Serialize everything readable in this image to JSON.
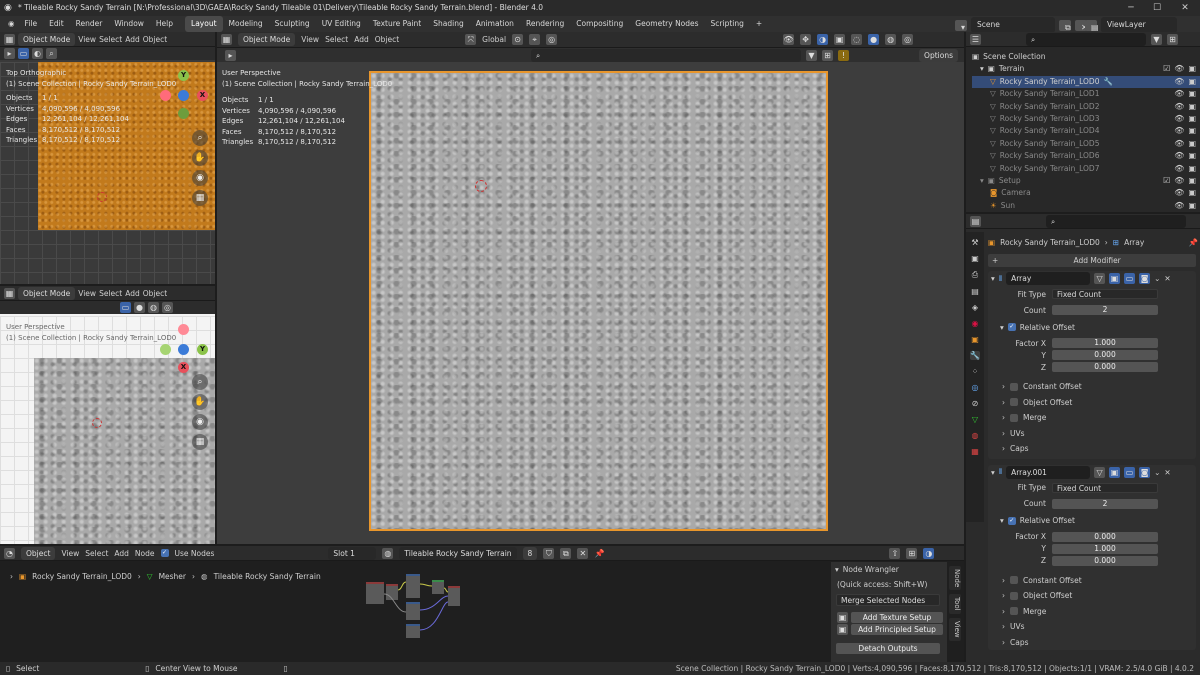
{
  "title": "* Tileable Rocky Sandy Terrain [N:\\Professional\\3D\\GAEA\\Rocky Sandy Tileable 01\\Delivery\\Tileable Rocky Sandy Terrain.blend] - Blender 4.0",
  "menu": [
    "File",
    "Edit",
    "Render",
    "Window",
    "Help"
  ],
  "workspaces": [
    "Layout",
    "Modeling",
    "Sculpting",
    "UV Editing",
    "Texture Paint",
    "Shading",
    "Animation",
    "Rendering",
    "Compositing",
    "Geometry Nodes",
    "Scripting"
  ],
  "active_workspace": "Layout",
  "scene": "Scene",
  "view_layer": "ViewLayer",
  "viewport_header": {
    "mode": "Object Mode",
    "view": "View",
    "select": "Select",
    "add": "Add",
    "object": "Object",
    "orientation": "Global",
    "options": "Options"
  },
  "vp_topleft": {
    "view_name": "Top Orthographic",
    "collection": "(1) Scene Collection | Rocky Sandy Terrain_LOD0",
    "stats": [
      [
        "Objects",
        "1 / 1"
      ],
      [
        "Vertices",
        "4,090,596 / 4,090,596"
      ],
      [
        "Edges",
        "12,261,104 / 12,261,104"
      ],
      [
        "Faces",
        "8,170,512 / 8,170,512"
      ],
      [
        "Triangles",
        "8,170,512 / 8,170,512"
      ]
    ]
  },
  "vp_bottomleft": {
    "view_name": "User Perspective",
    "collection": "(1) Scene Collection | Rocky Sandy Terrain_LOD0"
  },
  "vp_main": {
    "view_name": "User Perspective",
    "collection": "(1) Scene Collection | Rocky Sandy Terrain_LOD0",
    "stats": [
      [
        "Objects",
        "1 / 1"
      ],
      [
        "Vertices",
        "4,090,596 / 4,090,596"
      ],
      [
        "Edges",
        "12,261,104 / 12,261,104"
      ],
      [
        "Faces",
        "8,170,512 / 8,170,512"
      ],
      [
        "Triangles",
        "8,170,512 / 8,170,512"
      ]
    ]
  },
  "outliner": {
    "root": "Scene Collection",
    "collections": [
      {
        "name": "Terrain",
        "items": [
          "Rocky Sandy Terrain_LOD0",
          "Rocky Sandy Terrain_LOD1",
          "Rocky Sandy Terrain_LOD2",
          "Rocky Sandy Terrain_LOD3",
          "Rocky Sandy Terrain_LOD4",
          "Rocky Sandy Terrain_LOD5",
          "Rocky Sandy Terrain_LOD6",
          "Rocky Sandy Terrain_LOD7"
        ]
      },
      {
        "name": "Setup",
        "items": [
          "Camera",
          "Sun"
        ]
      }
    ],
    "selected": "Rocky Sandy Terrain_LOD0"
  },
  "properties": {
    "breadcrumb_object": "Rocky Sandy Terrain_LOD0",
    "breadcrumb_modifier": "Array",
    "add_modifier": "Add Modifier",
    "modifiers": [
      {
        "name": "Array",
        "fit_type_label": "Fit Type",
        "fit_type": "Fixed Count",
        "count_label": "Count",
        "count": "2",
        "relative_offset": "Relative Offset",
        "factor_labels": [
          "Factor X",
          "Y",
          "Z"
        ],
        "factors": [
          "1.000",
          "0.000",
          "0.000"
        ],
        "subpanels": [
          "Constant Offset",
          "Object Offset",
          "Merge",
          "UVs",
          "Caps"
        ]
      },
      {
        "name": "Array.001",
        "fit_type_label": "Fit Type",
        "fit_type": "Fixed Count",
        "count_label": "Count",
        "count": "2",
        "relative_offset": "Relative Offset",
        "factor_labels": [
          "Factor X",
          "Y",
          "Z"
        ],
        "factors": [
          "0.000",
          "1.000",
          "0.000"
        ],
        "subpanels": [
          "Constant Offset",
          "Object Offset",
          "Merge",
          "UVs",
          "Caps"
        ]
      }
    ]
  },
  "node_editor": {
    "header": {
      "type": "Object",
      "view": "View",
      "select": "Select",
      "add": "Add",
      "node": "Node",
      "use_nodes": "Use Nodes",
      "slot": "Slot 1",
      "material": "Tileable Rocky Sandy Terrain",
      "users": "8"
    },
    "breadcrumb": [
      "Rocky Sandy Terrain_LOD0",
      "Mesher",
      "Tileable Rocky Sandy Terrain"
    ],
    "panel": {
      "title": "Node Wrangler",
      "quick": "(Quick access: Shift+W)",
      "merge": "Merge Selected Nodes",
      "buttons": [
        "Add Texture Setup",
        "Add Principled Setup"
      ],
      "detach": "Detach Outputs"
    },
    "tabs": [
      "Node",
      "Tool",
      "View"
    ]
  },
  "status": {
    "select": "Select",
    "center": "Center View to Mouse",
    "right": "Scene Collection | Rocky Sandy Terrain_LOD0 | Verts:4,090,596 | Faces:8,170,512 | Tris:8,170,512 | Objects:1/1 | VRAM: 2.5/4.0 GiB | 4.0.2"
  },
  "colors": {
    "accent": "#4772b3",
    "selection_outline": "#e8962c",
    "terrain_orange": "#c27a1c",
    "terrain_gray": "#a9a9a9"
  }
}
